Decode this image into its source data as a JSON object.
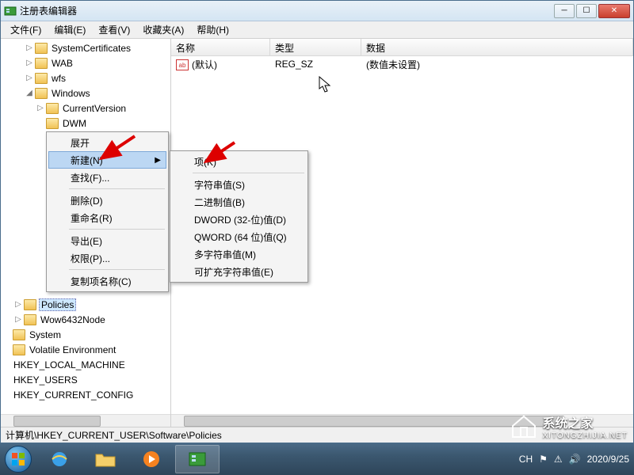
{
  "window": {
    "title": "注册表编辑器"
  },
  "menubar": [
    "文件(F)",
    "编辑(E)",
    "查看(V)",
    "收藏夹(A)",
    "帮助(H)"
  ],
  "tree": {
    "items": [
      {
        "indent": 2,
        "exp": "▷",
        "label": "SystemCertificates"
      },
      {
        "indent": 2,
        "exp": "▷",
        "label": "WAB"
      },
      {
        "indent": 2,
        "exp": "▷",
        "label": "wfs"
      },
      {
        "indent": 2,
        "exp": "◢",
        "label": "Windows"
      },
      {
        "indent": 3,
        "exp": "▷",
        "label": "CurrentVersion"
      },
      {
        "indent": 3,
        "exp": "",
        "label": "DWM"
      },
      {
        "indent": 1,
        "exp": "▷",
        "label": "Policies",
        "selected": true
      },
      {
        "indent": 1,
        "exp": "▷",
        "label": "Wow6432Node"
      },
      {
        "indent": 0,
        "exp": "",
        "label": "System"
      },
      {
        "indent": 0,
        "exp": "",
        "label": "Volatile Environment"
      },
      {
        "indent": 0,
        "exp": "",
        "label": "HKEY_LOCAL_MACHINE",
        "nofolder": true
      },
      {
        "indent": 0,
        "exp": "",
        "label": "HKEY_USERS",
        "nofolder": true
      },
      {
        "indent": 0,
        "exp": "",
        "label": "HKEY_CURRENT_CONFIG",
        "nofolder": true
      }
    ]
  },
  "list": {
    "columns": {
      "name": "名称",
      "type": "类型",
      "data": "数据"
    },
    "rows": [
      {
        "name": "(默认)",
        "type": "REG_SZ",
        "data": "(数值未设置)"
      }
    ]
  },
  "context_menu_1": {
    "items": [
      {
        "label": "展开",
        "kind": "item"
      },
      {
        "label": "新建(N)",
        "kind": "item",
        "hover": true,
        "submenu": true
      },
      {
        "label": "查找(F)...",
        "kind": "item"
      },
      {
        "kind": "sep"
      },
      {
        "label": "删除(D)",
        "kind": "item"
      },
      {
        "label": "重命名(R)",
        "kind": "item"
      },
      {
        "kind": "sep"
      },
      {
        "label": "导出(E)",
        "kind": "item"
      },
      {
        "label": "权限(P)...",
        "kind": "item"
      },
      {
        "kind": "sep"
      },
      {
        "label": "复制项名称(C)",
        "kind": "item"
      }
    ]
  },
  "context_menu_2": {
    "items": [
      {
        "label": "项(K)",
        "kind": "item"
      },
      {
        "kind": "sep"
      },
      {
        "label": "字符串值(S)",
        "kind": "item"
      },
      {
        "label": "二进制值(B)",
        "kind": "item"
      },
      {
        "label": "DWORD (32-位)值(D)",
        "kind": "item"
      },
      {
        "label": "QWORD (64 位)值(Q)",
        "kind": "item"
      },
      {
        "label": "多字符串值(M)",
        "kind": "item"
      },
      {
        "label": "可扩充字符串值(E)",
        "kind": "item"
      }
    ]
  },
  "statusbar": {
    "path": "计算机\\HKEY_CURRENT_USER\\Software\\Policies"
  },
  "tray": {
    "ime": "CH",
    "datetime": "2020/9/25"
  },
  "watermark": {
    "line1": "系统之家",
    "line2": "XITONGZHIJIA.NET"
  }
}
